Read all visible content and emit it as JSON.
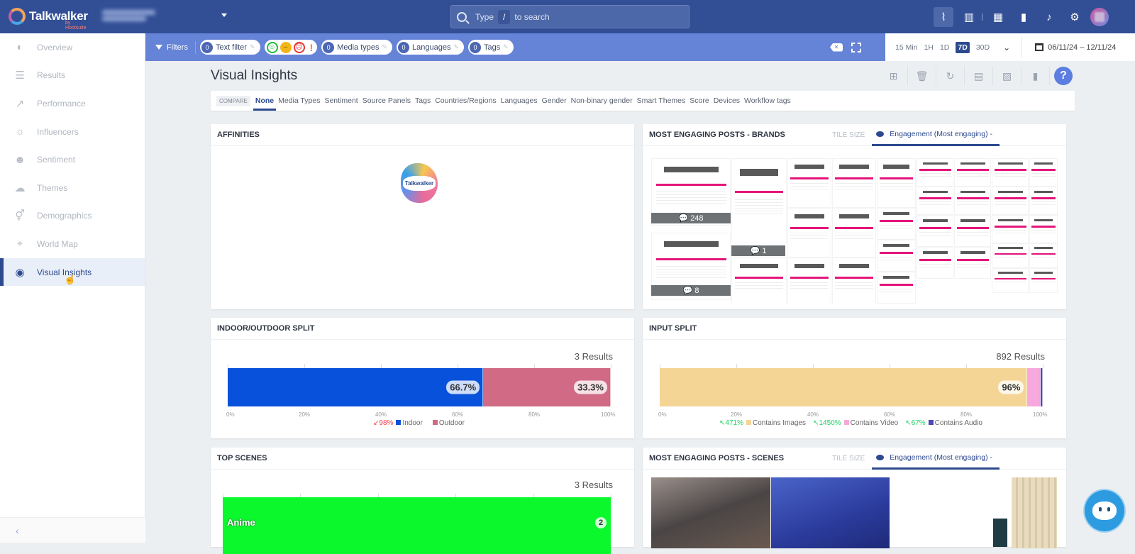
{
  "topbar": {
    "brand": "Talkwalker",
    "brand_sub": "by Hootsuite",
    "search": {
      "prefix": "Type",
      "key": "/",
      "suffix": "to search"
    },
    "icons": [
      "analytics-icon",
      "dashboard-icon",
      "grid-icon",
      "bookmark-icon",
      "bell-icon",
      "gear-icon"
    ]
  },
  "sidebar": {
    "items": [
      {
        "label": "Overview",
        "icon": "◐"
      },
      {
        "label": "Results",
        "icon": "☰"
      },
      {
        "label": "Performance",
        "icon": "↗"
      },
      {
        "label": "Influencers",
        "icon": "☼"
      },
      {
        "label": "Sentiment",
        "icon": "☻"
      },
      {
        "label": "Themes",
        "icon": "☁"
      },
      {
        "label": "Demographics",
        "icon": "⚥"
      },
      {
        "label": "World Map",
        "icon": "⌖"
      },
      {
        "label": "Visual Insights",
        "icon": "◉"
      }
    ],
    "active": "Visual Insights",
    "collapse": "‹"
  },
  "filterbar": {
    "filters_label": "Filters",
    "chips": [
      {
        "count": "0",
        "label": "Text filter"
      },
      {
        "count": "0",
        "label": "Media types"
      },
      {
        "count": "0",
        "label": "Languages"
      },
      {
        "count": "0",
        "label": "Tags"
      }
    ],
    "sentiment": {
      "positive": "☺",
      "neutral": "–",
      "negative": "☹",
      "unknown": "!"
    }
  },
  "timebar": {
    "ranges": [
      "15 Min",
      "1H",
      "1D",
      "7D",
      "30D"
    ],
    "active": "7D",
    "date_range": "06/11/24 – 12/11/24"
  },
  "page": {
    "title": "Visual Insights",
    "help": "?",
    "compare_label": "COMPARE",
    "compare_tabs": [
      "None",
      "Media Types",
      "Sentiment",
      "Source Panels",
      "Tags",
      "Countries/Regions",
      "Languages",
      "Gender",
      "Non-binary gender",
      "Smart Themes",
      "Score",
      "Devices",
      "Workflow tags"
    ],
    "compare_active": "None"
  },
  "cards": {
    "affinities": {
      "title": "AFFINITIES",
      "logo_text": "Talkwalker"
    },
    "brands": {
      "title": "MOST ENGAGING POSTS - BRANDS",
      "tile_size": "TILE SIZE",
      "sort": "Engagement (Most engaging) -",
      "counts": [
        "248",
        "1",
        "8"
      ]
    },
    "indoor": {
      "title": "INDOOR/OUTDOOR SPLIT",
      "results": "3 Results",
      "ticks": [
        "0%",
        "20%",
        "40%",
        "60%",
        "80%",
        "100%"
      ],
      "legend": [
        {
          "change": "98%",
          "direction": "down",
          "label": "Indoor",
          "color": "#0751db"
        },
        {
          "label": "Outdoor",
          "color": "#d06a85"
        }
      ]
    },
    "input": {
      "title": "INPUT SPLIT",
      "results": "892 Results",
      "ticks": [
        "0%",
        "20%",
        "40%",
        "60%",
        "80%",
        "100%"
      ],
      "legend": [
        {
          "change": "471%",
          "direction": "up",
          "label": "Contains Images",
          "color": "#f5d596"
        },
        {
          "change": "1450%",
          "direction": "up",
          "label": "Contains Video",
          "color": "#f7a8dc"
        },
        {
          "change": "67%",
          "direction": "up",
          "label": "Contains Audio",
          "color": "#4b48b8"
        }
      ]
    },
    "scenes": {
      "title": "TOP SCENES",
      "results": "3 Results",
      "bars": [
        {
          "label": "Anime",
          "value": "2",
          "color": "#0bf82d"
        }
      ]
    },
    "scene_posts": {
      "title": "MOST ENGAGING POSTS - SCENES",
      "tile_size": "TILE SIZE",
      "sort": "Engagement (Most engaging) -"
    }
  },
  "chart_data": [
    {
      "type": "bar",
      "title": "INDOOR/OUTDOOR SPLIT",
      "stacked": true,
      "categories": [
        "Indoor",
        "Outdoor"
      ],
      "values": [
        66.7,
        33.3
      ],
      "labels": [
        "66.7%",
        "33.3%"
      ],
      "xlim": [
        0,
        100
      ],
      "xticks": [
        "0%",
        "20%",
        "40%",
        "60%",
        "80%",
        "100%"
      ],
      "legend": "bottom"
    },
    {
      "type": "bar",
      "title": "INPUT SPLIT",
      "stacked": true,
      "categories": [
        "Contains Images",
        "Contains Video",
        "Contains Audio"
      ],
      "values": [
        96,
        3.4,
        0.6
      ],
      "labels": [
        "96%",
        "",
        ""
      ],
      "xlim": [
        0,
        100
      ],
      "xticks": [
        "0%",
        "20%",
        "40%",
        "60%",
        "80%",
        "100%"
      ],
      "legend": "bottom"
    },
    {
      "type": "bar",
      "title": "TOP SCENES",
      "categories": [
        "Anime"
      ],
      "values": [
        2
      ],
      "legend": "none"
    }
  ]
}
